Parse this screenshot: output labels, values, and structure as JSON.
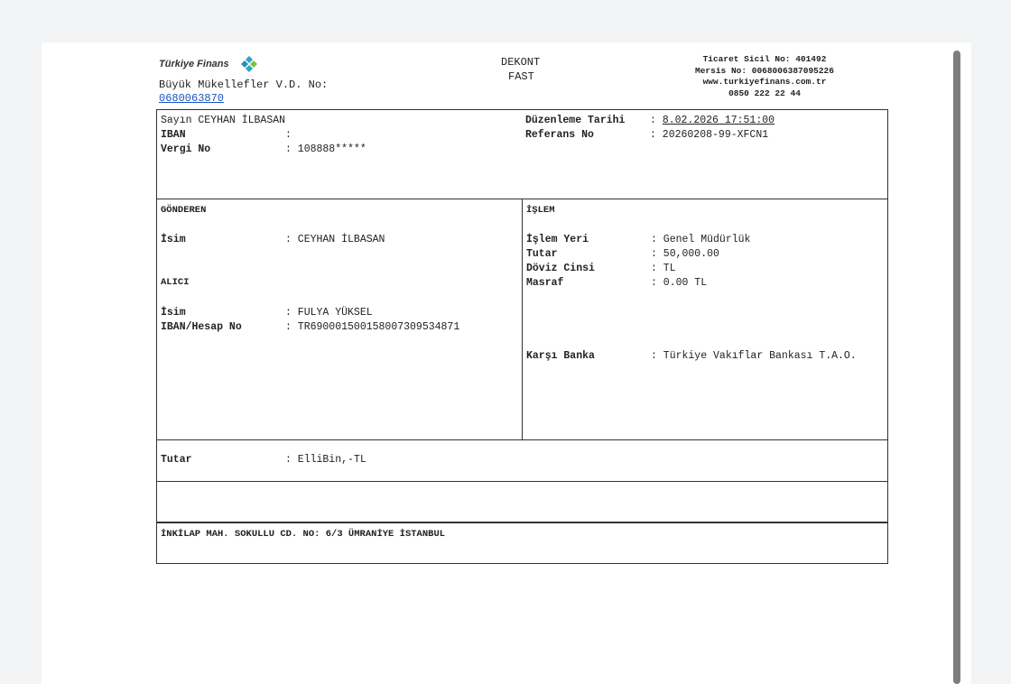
{
  "header": {
    "logo_text": "Türkiye Finans",
    "tax_office_label": "Büyük Mükellefler V.D. No:",
    "tax_office_no": "0680063870",
    "doc_type": "DEKONT",
    "doc_subtype": "FAST",
    "trade_registry": "Ticaret Sicil No: 401492",
    "mersis": "Mersis No: 0068006387095226",
    "website": "www.turkiyefinans.com.tr",
    "phone": "0850 222 22 44"
  },
  "customer": {
    "salutation": "Sayın CEYHAN İLBASAN",
    "iban_label": "IBAN",
    "iban_value": ":",
    "tax_no_label": "Vergi No",
    "tax_no_value": ": 108888*****",
    "date_label": "Düzenleme Tarihi",
    "date_sep": ":",
    "date_value": "8.02.2026 17:51:00",
    "ref_label": "Referans No",
    "ref_value": ": 20260208-99-XFCN1"
  },
  "sender": {
    "heading": "GÖNDEREN",
    "name_label": "İsim",
    "name_value": ": CEYHAN İLBASAN"
  },
  "receiver": {
    "heading": "ALICI",
    "name_label": "İsim",
    "name_value": ": FULYA YÜKSEL",
    "iban_label": "IBAN/Hesap No",
    "iban_value": ": TR690001500158007309534871"
  },
  "transaction": {
    "heading": "İŞLEM",
    "place_label": "İşlem Yeri",
    "place_value": ": Genel Müdürlük",
    "amount_label": "Tutar",
    "amount_value": ": 50,000.00",
    "currency_label": "Döviz Cinsi",
    "currency_value": ": TL",
    "fee_label": "Masraf",
    "fee_value": ": 0.00 TL",
    "bank_label": "Karşı Banka",
    "bank_value": ": Türkiye Vakıflar Bankası T.A.O."
  },
  "total": {
    "label": "Tutar",
    "value": ": ElliBin,-TL"
  },
  "footer": {
    "address": "İNKİLAP MAH. SOKULLU CD. NO: 6/3 ÜMRANİYE İSTANBUL"
  },
  "colors": {
    "logo_teal": "#27a7c4",
    "logo_green": "#7cc242",
    "link_blue": "#1a56c4"
  }
}
